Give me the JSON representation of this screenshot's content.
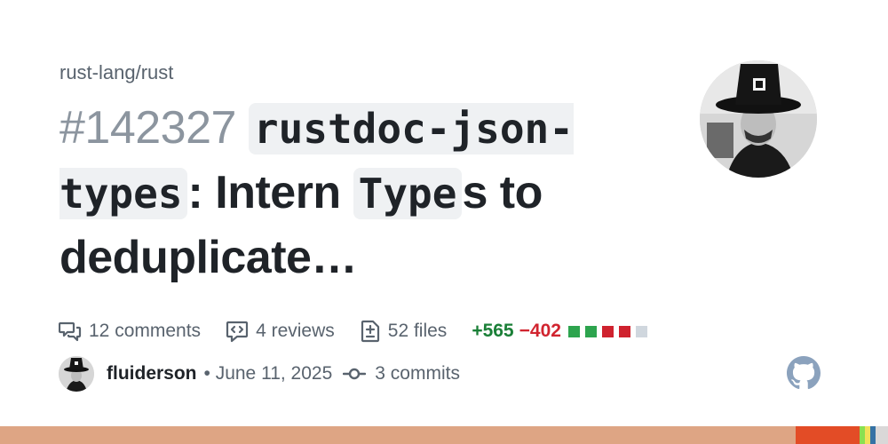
{
  "repo": "rust-lang/rust",
  "pr": {
    "number": "#142327",
    "title_code_1": "rustdoc-json-types",
    "title_text_1": ": Intern",
    "title_code_2": "Type",
    "title_text_2": "s to deduplicate…"
  },
  "stats": {
    "comments": "12 comments",
    "reviews": "4 reviews",
    "files": "52 files",
    "additions": "+565",
    "deletions": "−402",
    "diffstat": [
      "green",
      "green",
      "red",
      "red",
      "gray"
    ]
  },
  "author_row": {
    "author": "fluiderson",
    "date": "• June 11, 2025",
    "commits": "3 commits"
  },
  "icons": {
    "comments": "comments-icon",
    "reviews": "code-review-icon",
    "files": "file-diff-icon",
    "commits": "git-commit-icon",
    "logo": "github-mark-icon"
  },
  "colors": {
    "additions": "#1a7f37",
    "deletions": "#d1242f",
    "diff_green": "#2da44e",
    "diff_red": "#cf222e",
    "diff_gray": "#d0d7de",
    "language_bar": [
      "#dea584",
      "#e34c26",
      "#89e051",
      "#f1e05a",
      "#3572a5",
      "#dad8d8"
    ]
  }
}
